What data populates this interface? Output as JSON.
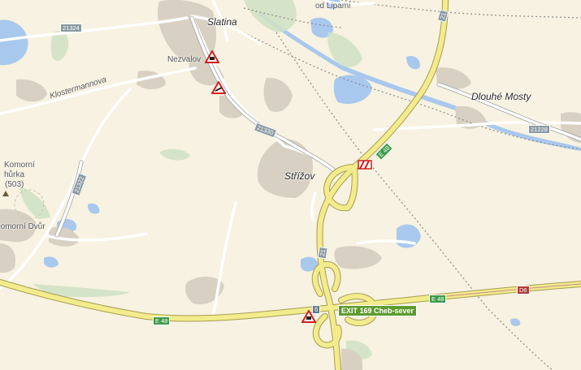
{
  "places": {
    "slatina": "Slatina",
    "nezvalov": "Nezvalov",
    "strizov": "Střížov",
    "dlouhe_mosty": "Dlouhé Mosty",
    "komorni_hurka_1": "Komorní",
    "komorni_hurka_2": "hůrka",
    "komorni_hurka_elev": "(503)",
    "komorni_dvur": "Komorní Dvůr",
    "lipami": "od Lipami"
  },
  "streets": {
    "klostermannova": "Klostermannova"
  },
  "road_numbers": {
    "r21324": "21324",
    "r21330": "21330",
    "r21322": "21322",
    "r21228": "21228",
    "e48_a": "E 48",
    "e48_b": "E 48",
    "e48_c": "E 48",
    "d21_a": "21",
    "d21_b": "21",
    "d6": "D6"
  },
  "exit": {
    "number": "6",
    "label": "EXIT 169 Cheb-sever"
  },
  "icons": [
    "traffic-warning-icon",
    "roadwork-warning-icon",
    "closure-icon",
    "peak-icon"
  ],
  "colors": {
    "background": "#f7f2e1",
    "water": "#a9c8ee",
    "motorway": "#f3ec8c",
    "motorway_outline": "#a79c52",
    "urban": "#d8d1c3",
    "green": "#cfe2c4",
    "road": "#ffffff",
    "exit_badge": "#5e9b2f"
  }
}
